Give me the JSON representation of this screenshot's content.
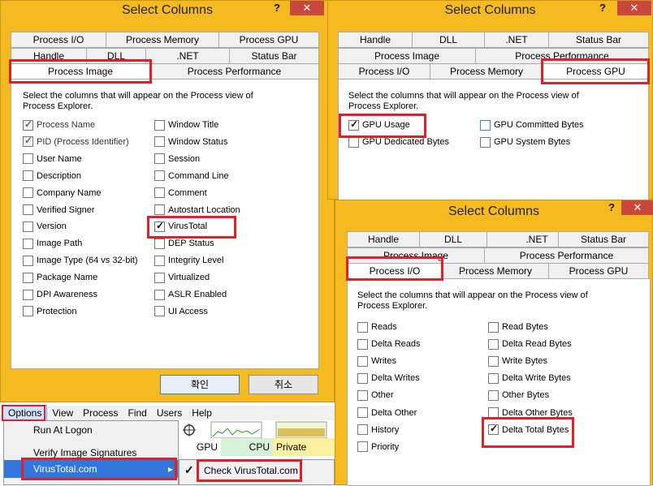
{
  "dialog_a": {
    "title": "Select Columns",
    "help": "?",
    "close": "✕",
    "tabs_row1": [
      "Process I/O",
      "Process Memory",
      "Process GPU"
    ],
    "tabs_row2": [
      "Handle",
      "DLL",
      ".NET",
      "Status Bar"
    ],
    "tabs_row3": [
      "Process Image",
      "Process Performance"
    ],
    "description": "Select the columns that will appear on the Process view of Process Explorer.",
    "left_options": [
      {
        "label": "Process Name",
        "checked": true,
        "disabled": true
      },
      {
        "label": "PID (Process Identifier)",
        "checked": true,
        "disabled": true
      },
      {
        "label": "User Name",
        "checked": false
      },
      {
        "label": "Description",
        "checked": false
      },
      {
        "label": "Company Name",
        "checked": false
      },
      {
        "label": "Verified Signer",
        "checked": false
      },
      {
        "label": "Version",
        "checked": false
      },
      {
        "label": "Image Path",
        "checked": false
      },
      {
        "label": "Image Type (64 vs 32-bit)",
        "checked": false
      },
      {
        "label": "Package Name",
        "checked": false
      },
      {
        "label": "DPI Awareness",
        "checked": false
      },
      {
        "label": "Protection",
        "checked": false
      }
    ],
    "right_options": [
      {
        "label": "Window Title",
        "checked": false
      },
      {
        "label": "Window Status",
        "checked": false
      },
      {
        "label": "Session",
        "checked": false
      },
      {
        "label": "Command Line",
        "checked": false
      },
      {
        "label": "Comment",
        "checked": false
      },
      {
        "label": "Autostart Location",
        "checked": false
      },
      {
        "label": "VirusTotal",
        "checked": true
      },
      {
        "label": "DEP Status",
        "checked": false
      },
      {
        "label": "Integrity Level",
        "checked": false
      },
      {
        "label": "Virtualized",
        "checked": false
      },
      {
        "label": "ASLR Enabled",
        "checked": false
      },
      {
        "label": "UI Access",
        "checked": false
      }
    ],
    "ok_label": "확인",
    "cancel_label": "취소"
  },
  "dialog_b": {
    "title": "Select Columns",
    "help": "?",
    "close": "✕",
    "tabs_row1": [
      "Handle",
      "DLL",
      ".NET",
      "Status Bar"
    ],
    "tabs_row2": [
      "Process Image",
      "Process Performance"
    ],
    "tabs_row3": [
      "Process I/O",
      "Process Memory",
      "Process GPU"
    ],
    "description": "Select the columns that will appear on the Process view of Process Explorer.",
    "options": [
      {
        "label": "GPU Usage",
        "checked": true
      },
      {
        "label": "GPU Committed Bytes",
        "checked": false
      },
      {
        "label": "GPU Dedicated Bytes",
        "checked": false
      },
      {
        "label": "GPU System Bytes",
        "checked": false
      }
    ]
  },
  "dialog_c": {
    "title": "Select Columns",
    "help": "?",
    "close": "✕",
    "tabs_row1": [
      "Handle",
      "DLL",
      ".NET",
      "Status Bar"
    ],
    "tabs_row2": [
      "Process Image",
      "Process Performance"
    ],
    "tabs_row3": [
      "Process I/O",
      "Process Memory",
      "Process GPU"
    ],
    "description": "Select the columns that will appear on the Process view of Process Explorer.",
    "left_options": [
      {
        "label": "Reads",
        "checked": false
      },
      {
        "label": "Delta Reads",
        "checked": false
      },
      {
        "label": "Writes",
        "checked": false
      },
      {
        "label": "Delta Writes",
        "checked": false
      },
      {
        "label": "Other",
        "checked": false
      },
      {
        "label": "Delta Other",
        "checked": false
      },
      {
        "label": "History",
        "checked": false
      },
      {
        "label": "Priority",
        "checked": false
      }
    ],
    "right_options": [
      {
        "label": "Read Bytes",
        "checked": false
      },
      {
        "label": "Delta Read Bytes",
        "checked": false
      },
      {
        "label": "Write Bytes",
        "checked": false
      },
      {
        "label": "Delta Write Bytes",
        "checked": false
      },
      {
        "label": "Other Bytes",
        "checked": false
      },
      {
        "label": "Delta Other Bytes",
        "checked": false
      },
      {
        "label": "Delta Total Bytes",
        "checked": true
      }
    ]
  },
  "menubar": {
    "items": [
      "Options",
      "View",
      "Process",
      "Find",
      "Users",
      "Help"
    ]
  },
  "options_menu": {
    "items": [
      "Run At Logon",
      "Verify Image Signatures",
      "VirusTotal.com"
    ],
    "submenu_arrow": "▸"
  },
  "submenu": {
    "check_mark": "✓",
    "item": "Check VirusTotal.com"
  },
  "columns": {
    "gpu": "GPU",
    "cpu": "CPU",
    "private": "Private Byt..."
  },
  "colors": {
    "window_frame": "#f5ba1f",
    "highlight": "#e0202a",
    "menu_selection": "#3377dd"
  }
}
